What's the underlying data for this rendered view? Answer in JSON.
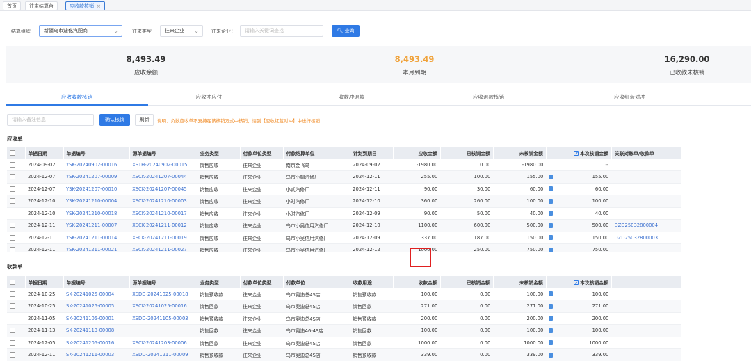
{
  "tabs": [
    {
      "label": "首页",
      "active": false
    },
    {
      "label": "往来结算台",
      "active": false
    },
    {
      "label": "应收款核销",
      "active": true
    }
  ],
  "filters": {
    "org_label": "结算组织",
    "org_value": "新疆乌市迪化汽配商",
    "type_label": "往来类型",
    "type_value": "往来企业",
    "company_label": "往来企业：",
    "company_placeholder": "请输入关键词查找",
    "query_button": "查询"
  },
  "summary": [
    {
      "value": "8,493.49",
      "label": "应收余额",
      "color": "#333333"
    },
    {
      "value": "8,493.49",
      "label": "本月到期",
      "color": "#f0a23a"
    },
    {
      "value": "16,290.00",
      "label": "已收款未核销",
      "color": "#333333"
    }
  ],
  "subtabs": [
    "应收收款核销",
    "应收冲应付",
    "收款冲退款",
    "应收退款核销",
    "应收红蓝对冲"
  ],
  "actions": {
    "remark_placeholder": "请输入备注信息",
    "confirm_button": "确认核销",
    "refresh_button": "刷新",
    "note": "说明：负数应收单不支持在该核销方式中核销，请到【应收红蓝对冲】中进行核销"
  },
  "receivable": {
    "title": "应收单",
    "columns": [
      "单据日期",
      "单据编号",
      "源单据编号",
      "业务类型",
      "付款单位类型",
      "付款结算单位",
      "计划到期日",
      "应收金额",
      "已核销金额",
      "未核销金额",
      "本次核销金额",
      "关联对账单/收款单"
    ],
    "rows": [
      [
        "2024-09-02",
        "YSK-20240902-00016",
        "XSTH-20240902-00015",
        "销售应收",
        "往来企业",
        "南京金飞鸟",
        "2024-09-02",
        "-1980.00",
        "0.00",
        "-1980.00",
        "",
        "--",
        ""
      ],
      [
        "2024-12-07",
        "YSK-20241207-00009",
        "XSCK-20241207-00044",
        "销售应收",
        "往来企业",
        "乌市小帽汽修厂",
        "2024-12-11",
        "255.00",
        "100.00",
        "155.00",
        "doc",
        "155.00",
        ""
      ],
      [
        "2024-12-07",
        "YSK-20241207-00010",
        "XSCK-20241207-00045",
        "销售应收",
        "往来企业",
        "小贰汽修厂",
        "2024-12-11",
        "90.00",
        "30.00",
        "60.00",
        "doc",
        "60.00",
        ""
      ],
      [
        "2024-12-10",
        "YSK-20241210-00004",
        "XSCK-20241210-00003",
        "销售应收",
        "往来企业",
        "小时汽修厂",
        "2024-12-10",
        "360.00",
        "260.00",
        "100.00",
        "doc",
        "100.00",
        ""
      ],
      [
        "2024-12-10",
        "YSK-20241210-00018",
        "XSCK-20241210-00017",
        "销售应收",
        "往来企业",
        "小时汽修厂",
        "2024-12-09",
        "90.00",
        "50.00",
        "40.00",
        "doc",
        "40.00",
        ""
      ],
      [
        "2024-12-11",
        "YSK-20241211-00007",
        "XSCK-20241211-00012",
        "销售应收",
        "往来企业",
        "乌市小吴信用汽修厂",
        "2024-12-10",
        "1100.00",
        "600.00",
        "500.00",
        "doc",
        "500.00",
        "DZD25032800004"
      ],
      [
        "2024-12-11",
        "YSK-20241211-00014",
        "XSCK-20241211-00019",
        "销售应收",
        "往来企业",
        "乌市小吴信用汽修厂",
        "2024-12-09",
        "337.00",
        "187.00",
        "150.00",
        "doc",
        "150.00",
        "DZD25032800003"
      ],
      [
        "2024-12-11",
        "YSK-20241211-00021",
        "XSCK-20241211-00027",
        "销售应收",
        "往来企业",
        "乌市小吴信用汽修厂",
        "2024-12-12",
        "1000.00",
        "250.00",
        "750.00",
        "doc",
        "750.00",
        ""
      ]
    ]
  },
  "payment": {
    "title": "收款单",
    "columns": [
      "单据日期",
      "单据编号",
      "源单据编号",
      "业务类型",
      "付款单位类型",
      "付款单位",
      "收款用途",
      "收款金额",
      "已核销金额",
      "未核销金额",
      "本次核销金额"
    ],
    "rows": [
      [
        "2024-10-25",
        "SK-20241025-00004",
        "XSDD-20241025-00018",
        "销售预收款",
        "往来企业",
        "乌市奥迪总4S店",
        "销售预收款",
        "100.00",
        "0.00",
        "100.00",
        "doc",
        "100.00"
      ],
      [
        "2024-10-25",
        "SK-20241025-00005",
        "XSCK-20241025-00016",
        "销售回款",
        "往来企业",
        "乌市奥迪总4S店",
        "销售回款",
        "271.00",
        "0.00",
        "271.00",
        "doc",
        "271.00"
      ],
      [
        "2024-11-05",
        "SK-20241105-00001",
        "XSDD-20241105-00003",
        "销售预收款",
        "往来企业",
        "乌市奥迪总4S店",
        "销售预收款",
        "200.00",
        "0.00",
        "200.00",
        "doc",
        "200.00"
      ],
      [
        "2024-11-13",
        "SK-20241113-00008",
        "",
        "销售回款",
        "往来企业",
        "乌市奥迪A6-4S店",
        "销售回款",
        "100.00",
        "0.00",
        "100.00",
        "doc",
        "100.00"
      ],
      [
        "2024-12-05",
        "SK-20241205-00016",
        "XSCK-20241203-00006",
        "销售回款",
        "往来企业",
        "乌市奥迪总4S店",
        "销售回款",
        "1000.00",
        "0.00",
        "1000.00",
        "doc",
        "1000.00"
      ],
      [
        "2024-12-11",
        "SK-20241211-00003",
        "XSDD-20241211-00009",
        "销售预收款",
        "往来企业",
        "乌市奥迪总4S店",
        "销售预收款",
        "339.00",
        "0.00",
        "339.00",
        "doc",
        "339.00"
      ]
    ]
  }
}
